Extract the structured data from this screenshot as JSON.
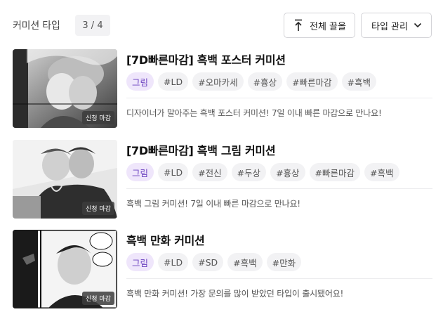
{
  "header": {
    "title": "커미션 타입",
    "count": "3 / 4",
    "pull_all_label": "전체 끌올",
    "manage_label": "타입 관리"
  },
  "thumb_badge": "신청 마감",
  "items": [
    {
      "title": "[7D빠른마감] 흑백 포스터 커미션",
      "tags": [
        "그림",
        "#LD",
        "#오마카세",
        "#흉상",
        "#빠른마감",
        "#흑백"
      ],
      "description": "디자이너가 말아주는 흑백 포스터 커미션! 7일 이내 빠른 마감으로 만나요!"
    },
    {
      "title": "[7D빠른마감] 흑백 그림 커미션",
      "tags": [
        "그림",
        "#LD",
        "#전신",
        "#두상",
        "#흉상",
        "#빠른마감",
        "#흑백"
      ],
      "description": "흑백 그림 커미션! 7일 이내 빠른 마감으로 만나요!"
    },
    {
      "title": "흑백 만화 커미션",
      "tags": [
        "그림",
        "#LD",
        "#SD",
        "#흑백",
        "#만화"
      ],
      "description": "흑백 만화 커미션! 가장 문의를 많이 받았던 타입이 출시됐어요!"
    }
  ],
  "icons": {
    "pull_all": "upload-arrow-icon",
    "manage": "chevron-down-icon"
  },
  "colors": {
    "primary_tag_bg": "#efe6fb",
    "primary_tag_text": "#6a3fbf",
    "tag_bg": "#f2f2f4"
  }
}
